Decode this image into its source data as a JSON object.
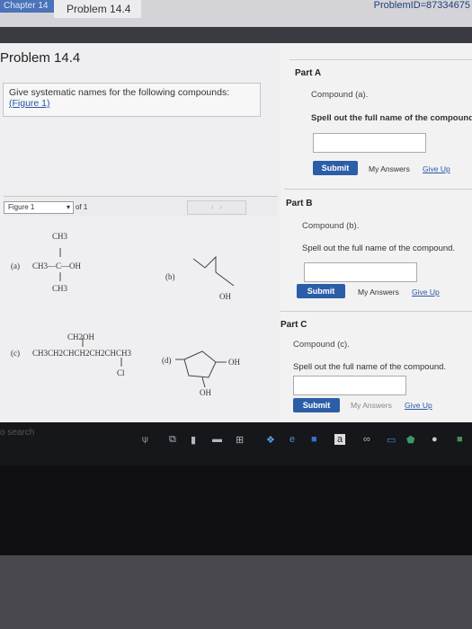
{
  "header": {
    "breadcrumb_chapter": "Chapter 14",
    "breadcrumb_problem": "Problem 14.4",
    "url_fragment": "ProblemID=87334675"
  },
  "problem": {
    "title": "Problem 14.4",
    "question": "Give systematic names for the following compounds:",
    "figure_link": "(Figure 1)"
  },
  "figure": {
    "select_value": "Figure 1",
    "of_text": "of 1",
    "compounds": {
      "a_label": "(a)",
      "a_top": "CH3",
      "a_main": "CH3—C—OH",
      "a_bottom": "CH3",
      "b_label": "(b)",
      "b_oh": "OH",
      "c_label": "(c)",
      "c_top": "CH2OH",
      "c_main": "CH3CH2CHCH2CH2CHCH3",
      "c_bottom": "Cl",
      "d_label": "(d)",
      "d_oh1": "OH",
      "d_oh2": "OH"
    }
  },
  "parts": [
    {
      "label": "Part A",
      "compound": "Compound (a).",
      "instruction": "Spell out the full name of the compound.",
      "answer_value": "",
      "submit": "Submit",
      "my_answers": "My Answers",
      "give_up": "Give Up"
    },
    {
      "label": "Part B",
      "compound": "Compound (b).",
      "instruction": "Spell out the full name of the compound.",
      "answer_value": "",
      "submit": "Submit",
      "my_answers": "My Answers",
      "give_up": "Give Up"
    },
    {
      "label": "Part C",
      "compound": "Compound (c).",
      "instruction": "Spell out the full name of the compound.",
      "answer_value": "",
      "submit": "Submit",
      "my_answers": "My Answers",
      "give_up": "Give Up"
    }
  ],
  "taskbar": {
    "search_placeholder": "o search",
    "app_letter": "a",
    "infinity": "∞"
  }
}
